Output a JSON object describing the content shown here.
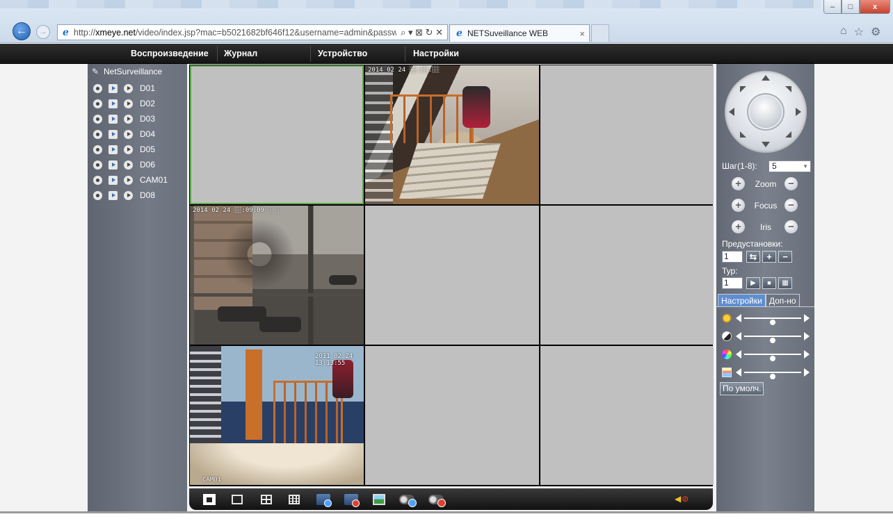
{
  "browser": {
    "url_host": "xmeye.net",
    "url_prefix": "http://",
    "url_rest": "/video/index.jsp?mac=b5021682bf646f12&username=admin&passw",
    "tab_title": "NETSuveillance WEB",
    "tab_close": "×",
    "win_min": "–",
    "win_max": "□",
    "win_close": "x",
    "addr_icons": "⌕ ▾ ⊠ ↻ ✕",
    "toolbar_icons": [
      "⌂",
      "☆",
      "⚙"
    ]
  },
  "menu": {
    "items": [
      "Воспроизведение",
      "Журнал",
      "Устройство",
      "Настройки"
    ]
  },
  "tree": {
    "root": "NetSurveillance",
    "channels": [
      "D01",
      "D02",
      "D03",
      "D04",
      "D05",
      "D06",
      "CAM01",
      "D08"
    ]
  },
  "grid": {
    "osd_1": "2014 02 24  ░░:░░:░░",
    "osd_2": "2014 02 24  ░░:09:09  ░  ░",
    "osd_3": "2011 02 24 13:13:55",
    "osd_3_label": "CAM01"
  },
  "ptz": {
    "step_label": "Шаг(1-8):",
    "step_value": "5",
    "zoom_label": "Zoom",
    "focus_label": "Focus",
    "iris_label": "Iris",
    "presets_label": "Предустановки:",
    "preset_value": "1",
    "tour_label": "Тур:",
    "tour_value": "1",
    "tab_settings": "Настройки",
    "tab_extra": "Доп-но",
    "default_button": "По умолч.",
    "sliders": {
      "brightness": 0.5,
      "contrast": 0.5,
      "saturation": 0.5,
      "hue": 0.5
    }
  },
  "colors": {
    "selected_cell_border": "#5fa84a",
    "active_tab": "#5f8ed0"
  }
}
